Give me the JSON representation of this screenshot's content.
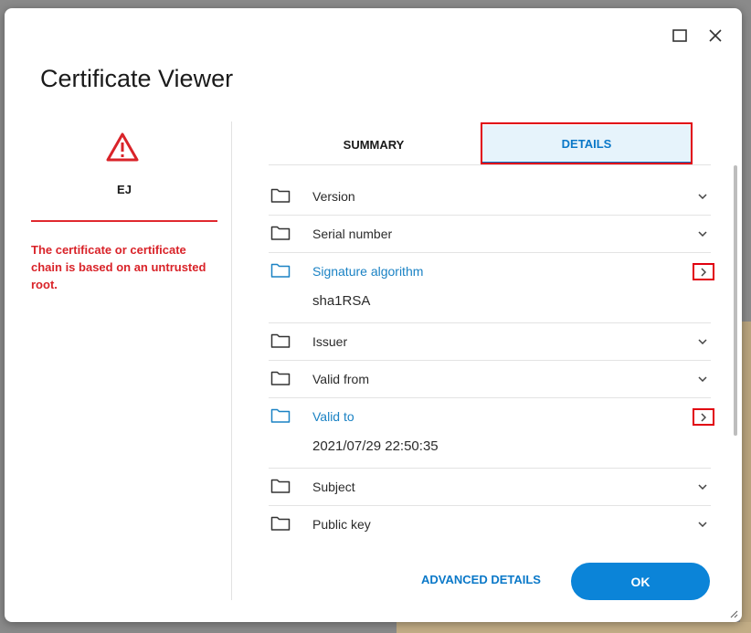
{
  "dialog": {
    "title": "Certificate Viewer",
    "certificate_name": "EJ",
    "warning": "The certificate or certificate chain is based on an untrusted root."
  },
  "tabs": [
    {
      "label": "SUMMARY",
      "selected": false
    },
    {
      "label": "DETAILS",
      "selected": true
    }
  ],
  "fields": [
    {
      "label": "Version",
      "expanded": false
    },
    {
      "label": "Serial number",
      "expanded": false
    },
    {
      "label": "Signature algorithm",
      "expanded": true,
      "value": "sha1RSA"
    },
    {
      "label": "Issuer",
      "expanded": false
    },
    {
      "label": "Valid from",
      "expanded": false
    },
    {
      "label": "Valid to",
      "expanded": true,
      "value": "2021/07/29 22:50:35"
    },
    {
      "label": "Subject",
      "expanded": false
    },
    {
      "label": "Public key",
      "expanded": false
    }
  ],
  "footer": {
    "advanced_label": "ADVANCED DETAILS",
    "ok_label": "OK"
  },
  "colors": {
    "accent": "#0b84d8",
    "warning": "#d92329",
    "highlight": "#e1000f"
  },
  "icons": [
    "maximize-icon",
    "close-icon",
    "warning-icon",
    "folder-icon",
    "chevron-down-icon",
    "chevron-right-icon",
    "resize-grip-icon"
  ]
}
